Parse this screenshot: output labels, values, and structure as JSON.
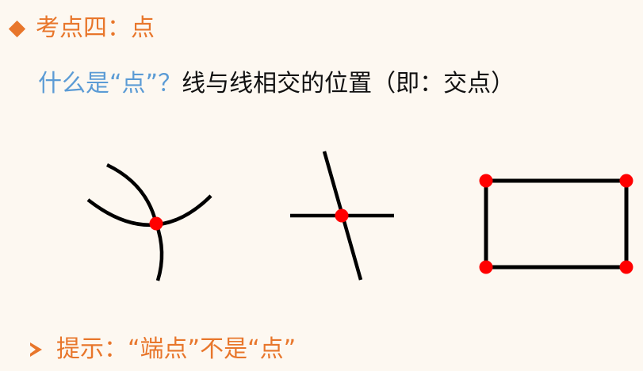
{
  "heading": {
    "marker": "diamond-icon",
    "title": "考点四：点"
  },
  "question": {
    "ask": "什么是“点”？",
    "answer": "线与线相交的位置（即：交点）"
  },
  "tip": {
    "marker": "arrowhead-icon",
    "text": "提示：“端点”不是“点”"
  },
  "colors": {
    "accent": "#e8762b",
    "question": "#5b9bd5",
    "line": "#000000",
    "point": "#ff0000",
    "background": "#fdf8f1"
  },
  "figures": [
    {
      "name": "three-curves",
      "points": 1
    },
    {
      "name": "two-crossing-lines",
      "points": 1
    },
    {
      "name": "rectangle",
      "points": 4
    }
  ]
}
